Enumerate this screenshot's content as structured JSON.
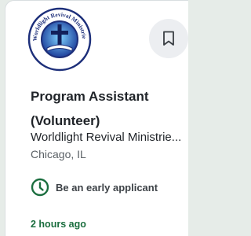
{
  "job": {
    "title": "Program Assistant (Volunteer)",
    "company": "Worldlight Revival Ministrie...",
    "location": "Chicago, IL",
    "badge": "Be an early applicant",
    "posted": "2 hours ago"
  },
  "logo": {
    "arc_text": "Worldlight Revival Ministries",
    "icon": "church-cross-globe-logo"
  },
  "icons": {
    "bookmark": "bookmark-icon",
    "clock": "clock-icon"
  },
  "colors": {
    "accent_green": "#1b6e3f",
    "logo_navy": "#1d2f7a",
    "page_bg": "#e6ece8"
  }
}
